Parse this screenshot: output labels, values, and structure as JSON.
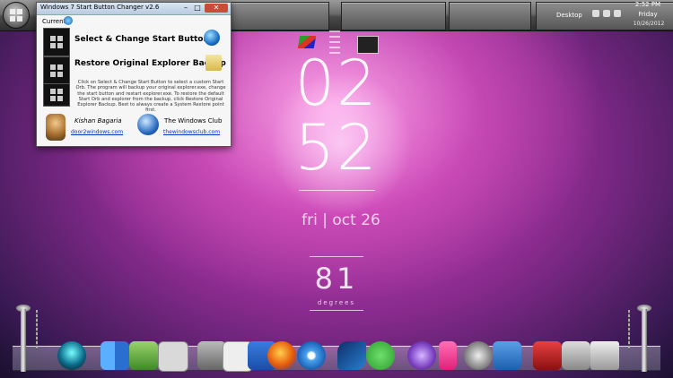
{
  "window": {
    "title": "Windows 7 Start Button Changer v2.6",
    "current_label": "Current",
    "close_label": "✕",
    "min_label": "–",
    "max_label": "□",
    "action1": "Select & Change Start Button",
    "action2": "Restore Original Explorer Backup",
    "description": "Click on Select & Change Start Button to select a custom Start Orb. The program will backup your original explorer.exe, change the start button and restart explorer.exe. To restore the default Start Orb and explorer from the backup, click Restore Original Explorer Backup. Best to always create a System Restore point first.",
    "author1_name": "Kishan Bagaria",
    "author1_link": "door2windows.com",
    "author2_name": "The Windows Club",
    "author2_link": "thewindowsclub.com"
  },
  "taskbar": {
    "desktop_label": "Desktop",
    "time": "2:52 PM",
    "day": "Friday",
    "date": "10/26/2012"
  },
  "clock_widget": {
    "hour": "02",
    "minute": "52",
    "date_line": "fri | oct 26",
    "temperature": "81",
    "temperature_unit": "degrees"
  },
  "dock": {
    "icons": [
      "clock-icon",
      "finder-icon",
      "app-store-icon",
      "preview-icon",
      "folder-icon",
      "gamepad-icon",
      "messages-icon",
      "firefox-icon",
      "safari-icon",
      "dolphin-icon",
      "utorrent-icon",
      "itunes-icon",
      "ipod-icon",
      "media-icon",
      "photos-icon",
      "flashget-icon",
      "mail-icon",
      "trash-icon"
    ]
  },
  "colors": {
    "accent": "#c13fb1",
    "window_close": "#c94b3a",
    "link": "#0033cc"
  }
}
